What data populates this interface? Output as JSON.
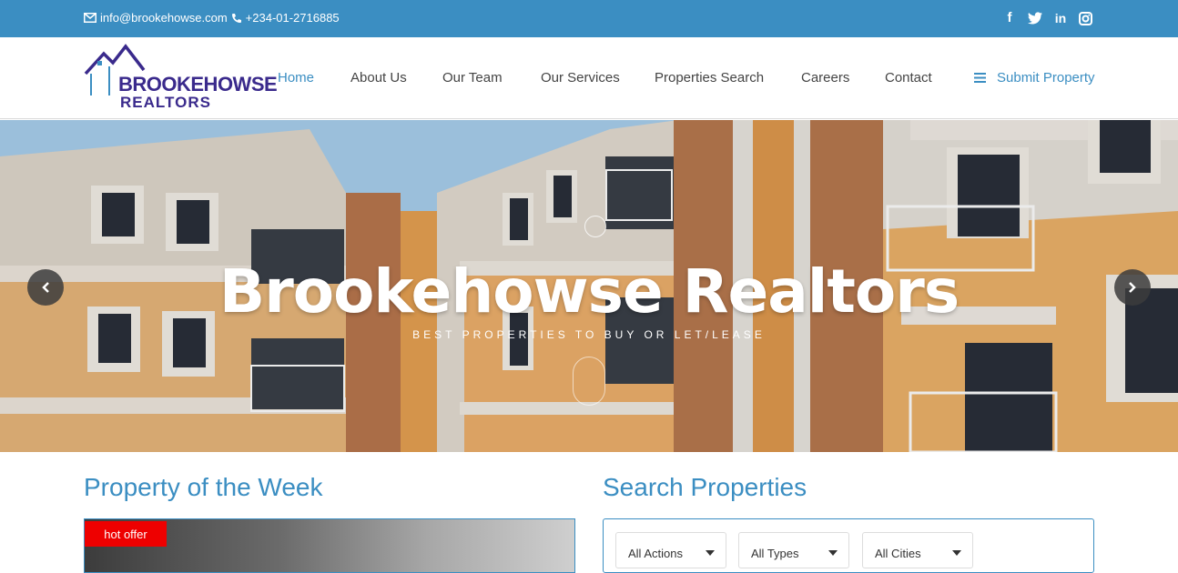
{
  "topbar": {
    "email": "info@brookehowse.com",
    "phone": "+234-01-2716885",
    "social": [
      "facebook-icon",
      "twitter-icon",
      "linkedin-icon",
      "instagram-icon"
    ],
    "background": "#3b8ec2"
  },
  "logo": {
    "line1": "BROOKEHOWSE",
    "line2": "REALTORS"
  },
  "nav": {
    "items": [
      {
        "label": "Home",
        "active": true
      },
      {
        "label": "About Us",
        "active": false
      },
      {
        "label": "Our Team",
        "active": false
      },
      {
        "label": "Our Services",
        "active": false
      },
      {
        "label": "Properties Search",
        "active": false
      },
      {
        "label": "Careers",
        "active": false
      },
      {
        "label": "Contact",
        "active": false
      }
    ],
    "submit_label": "Submit Property"
  },
  "hero": {
    "title": "Brookehowse Realtors",
    "subtitle": "BEST PROPERTIES TO BUY OR LET/LEASE"
  },
  "property_of_week": {
    "title": "Property of the Week",
    "badge": "hot offer"
  },
  "search": {
    "title": "Search Properties",
    "filters": [
      {
        "selected": "All Actions"
      },
      {
        "selected": "All Types"
      },
      {
        "selected": "All Cities"
      }
    ]
  },
  "colors": {
    "accent": "#3b8ec2",
    "badge": "#ee0000"
  }
}
